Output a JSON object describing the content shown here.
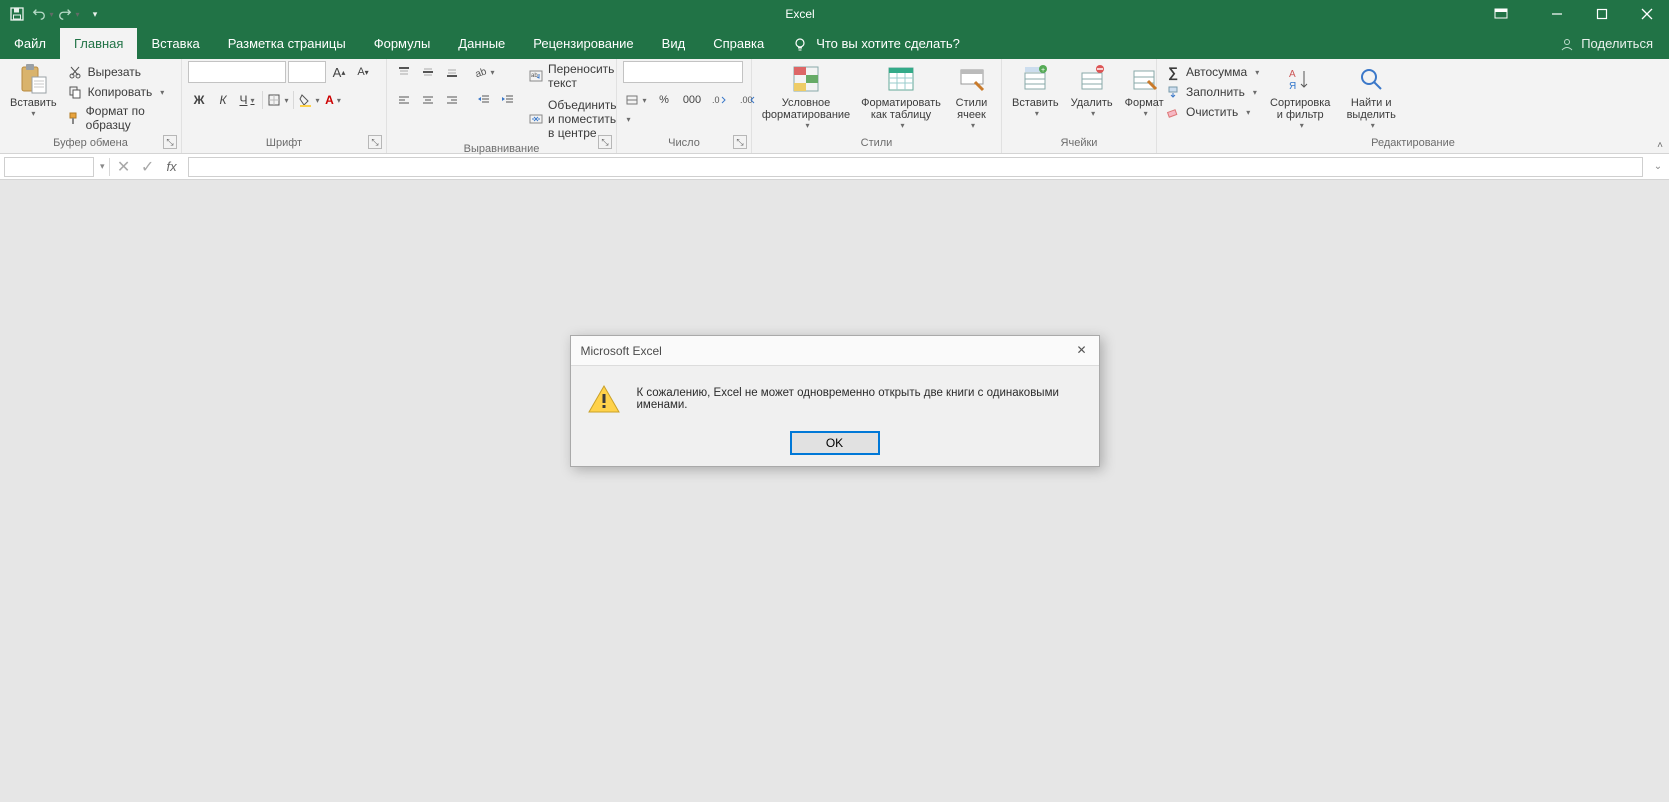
{
  "app_title": "Excel",
  "share_label": "Поделиться",
  "tabs": {
    "file": "Файл",
    "home": "Главная",
    "insert": "Вставка",
    "page_layout": "Разметка страницы",
    "formulas": "Формулы",
    "data": "Данные",
    "review": "Рецензирование",
    "view": "Вид",
    "help": "Справка",
    "tell_me": "Что вы хотите сделать?"
  },
  "clipboard": {
    "paste": "Вставить",
    "cut": "Вырезать",
    "copy": "Копировать",
    "format_painter": "Формат по образцу",
    "group": "Буфер обмена"
  },
  "font": {
    "group": "Шрифт",
    "bold": "Ж",
    "italic": "К",
    "underline": "Ч",
    "font_name": "",
    "font_size": ""
  },
  "alignment": {
    "group": "Выравнивание",
    "wrap": "Переносить текст",
    "merge": "Объединить и поместить в центре"
  },
  "number": {
    "group": "Число",
    "format": "",
    "percent": "%",
    "thousands": "000"
  },
  "styles": {
    "group": "Стили",
    "cond_fmt": "Условное форматирование",
    "as_table": "Форматировать как таблицу",
    "cell_styles": "Стили ячеек"
  },
  "cells": {
    "group": "Ячейки",
    "insert": "Вставить",
    "delete": "Удалить",
    "format": "Формат"
  },
  "editing": {
    "group": "Редактирование",
    "autosum": "Автосумма",
    "fill": "Заполнить",
    "clear": "Очистить",
    "sort": "Сортировка и фильтр",
    "find": "Найти и выделить"
  },
  "formula_bar": {
    "name_box": "",
    "formula": ""
  },
  "dialog": {
    "title": "Microsoft Excel",
    "message": "К сожалению, Excel не может одновременно открыть две книги с одинаковыми именами.",
    "ok": "OK"
  }
}
